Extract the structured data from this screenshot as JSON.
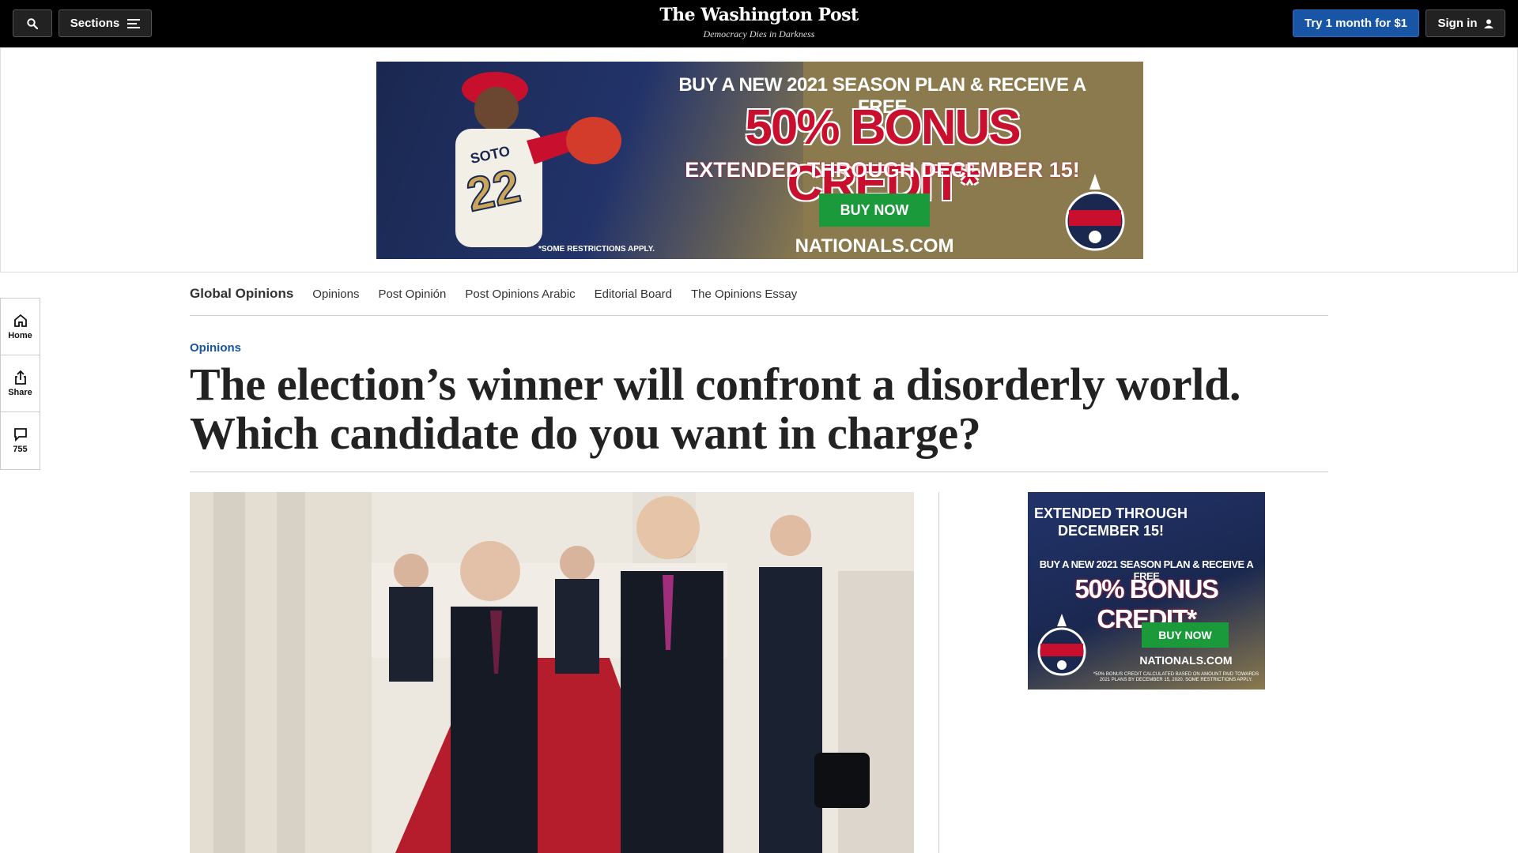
{
  "header": {
    "sections_label": "Sections",
    "logo_text": "The Washington Post",
    "tagline": "Democracy Dies in Darkness",
    "trial_label": "Try 1 month for $1",
    "signin_label": "Sign in"
  },
  "ad_top": {
    "line1": "BUY A NEW 2021 SEASON PLAN & RECEIVE A FREE",
    "line2": "50% BONUS CREDIT*",
    "line3": "EXTENDED THROUGH DECEMBER 15!",
    "button": "BUY NOW",
    "site": "NATIONALS.COM",
    "restrictions": "*SOME RESTRICTIONS APPLY."
  },
  "rail": {
    "home_label": "Home",
    "share_label": "Share",
    "comments_count": "755"
  },
  "section_nav": {
    "current": "Global Opinions",
    "links": [
      "Opinions",
      "Post Opinión",
      "Post Opinions Arabic",
      "Editorial Board",
      "The Opinions Essay"
    ]
  },
  "article": {
    "kicker": "Opinions",
    "headline": "The election’s winner will confront a disorderly world. Which candidate do you want in charge?"
  },
  "ad_side": {
    "line1": "EXTENDED THROUGH DECEMBER 15!",
    "line2": "BUY A NEW 2021 SEASON PLAN & RECEIVE A FREE",
    "line3": "50% BONUS CREDIT*",
    "button": "BUY NOW",
    "site": "NATIONALS.COM",
    "fine_print": "*50% BONUS CREDIT CALCULATED BASED ON AMOUNT PAID TOWARDS 2021 PLANS BY DECEMBER 15, 2020. SOME RESTRICTIONS APPLY."
  },
  "colors": {
    "accent_blue": "#1955a5",
    "nationals_red": "#c8102e",
    "nationals_navy": "#1a2850",
    "buy_green": "#1a9a3a"
  },
  "icons": [
    "search-icon",
    "menu-icon",
    "user-icon",
    "home-icon",
    "share-icon",
    "comment-icon"
  ]
}
